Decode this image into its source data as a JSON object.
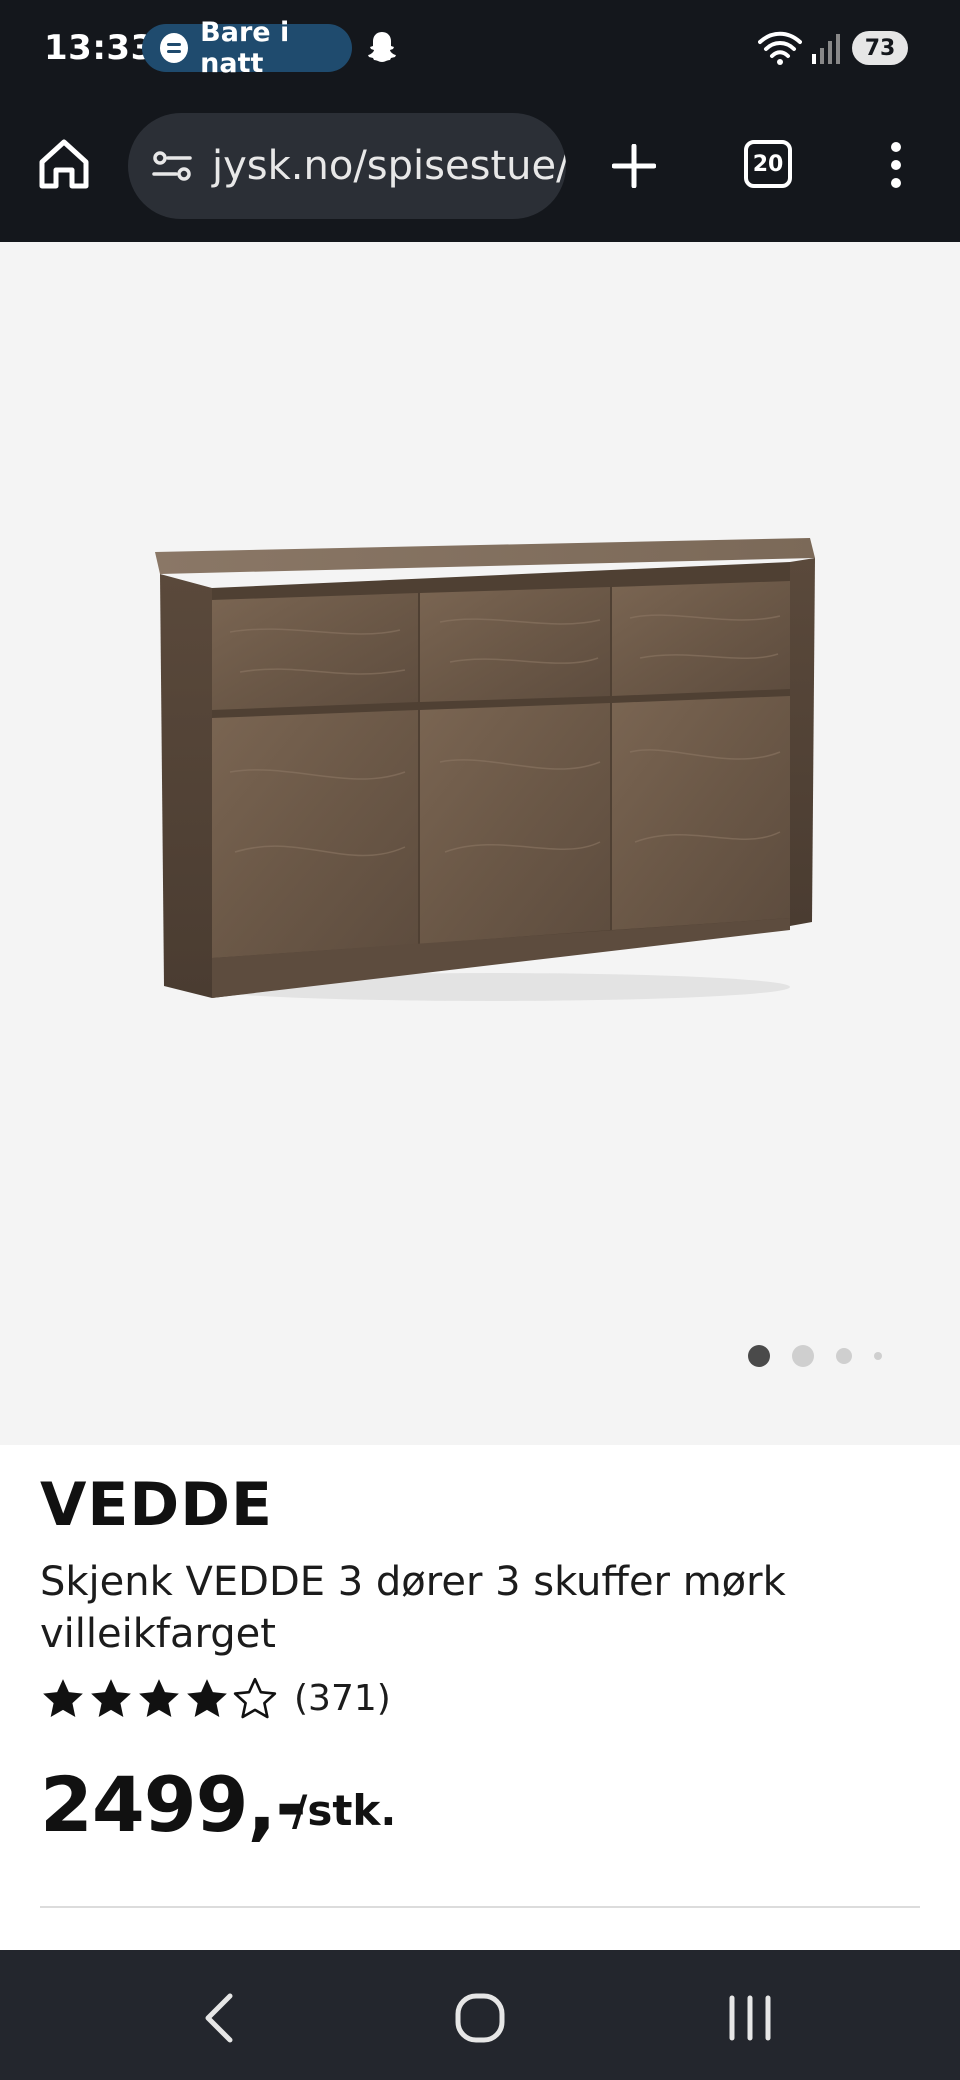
{
  "status_bar": {
    "time": "13:33",
    "media_pill": "Bare i natt",
    "battery": "73"
  },
  "browser": {
    "url": "jysk.no/spisestue/",
    "tab_count": "20"
  },
  "gallery": {
    "total_images": 4,
    "active_index": 0
  },
  "product": {
    "brand": "VEDDE",
    "title": "Skjenk VEDDE 3 dører 3 skuffer mørk villeikfarget",
    "rating": 4.5,
    "rating_max": 5,
    "review_count": "(371)",
    "price": "2499,-",
    "unit": "/stk."
  },
  "colors": {
    "chrome": "#14171c",
    "url_bar": "#2b2f36",
    "pill": "#1f4b6e",
    "gallery_bg": "#f4f4f4",
    "nav_bar": "#23262d"
  }
}
